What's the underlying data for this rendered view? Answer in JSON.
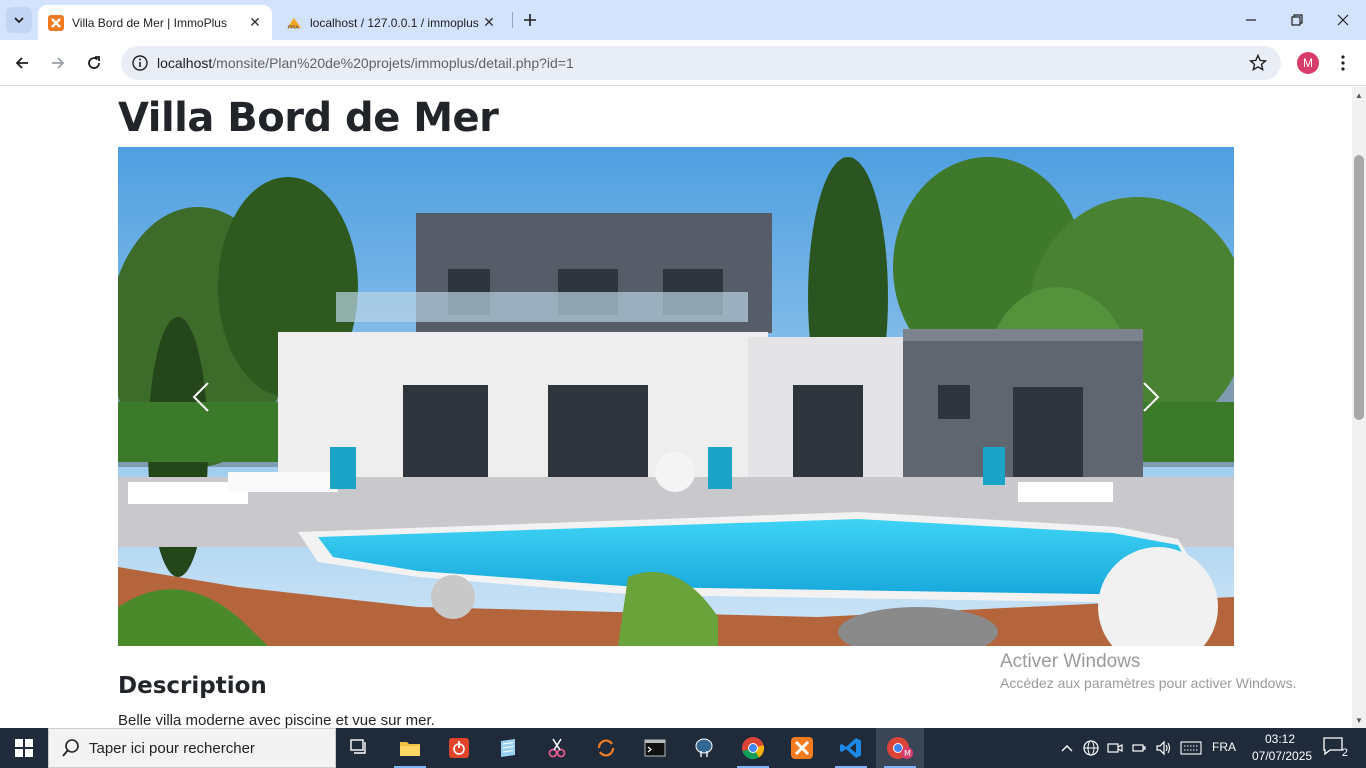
{
  "browser": {
    "tabs": [
      {
        "title": "Villa Bord de Mer | ImmoPlus",
        "active": true
      },
      {
        "title": "localhost / 127.0.0.1 / immoplus",
        "active": false
      }
    ],
    "url_host": "localhost",
    "url_path": "/monsite/Plan%20de%20projets/immoplus/detail.php?id=1",
    "profile_initial": "M"
  },
  "page": {
    "title": "Villa Bord de Mer",
    "carousel": {
      "prev_icon": "chevron-left-icon",
      "next_icon": "chevron-right-icon"
    },
    "section_title": "Description",
    "description": "Belle villa moderne avec piscine et vue sur mer."
  },
  "watermark": {
    "title": "Activer Windows",
    "subtitle": "Accédez aux paramètres pour activer Windows."
  },
  "taskbar": {
    "search_placeholder": "Taper ici pour rechercher",
    "language": "FRA",
    "time": "03:12",
    "date": "07/07/2025",
    "notification_count": "2"
  },
  "colors": {
    "tabstrip": "#d3e3fd",
    "taskbar": "#1f2a3a",
    "pool": "#29c3ea"
  }
}
